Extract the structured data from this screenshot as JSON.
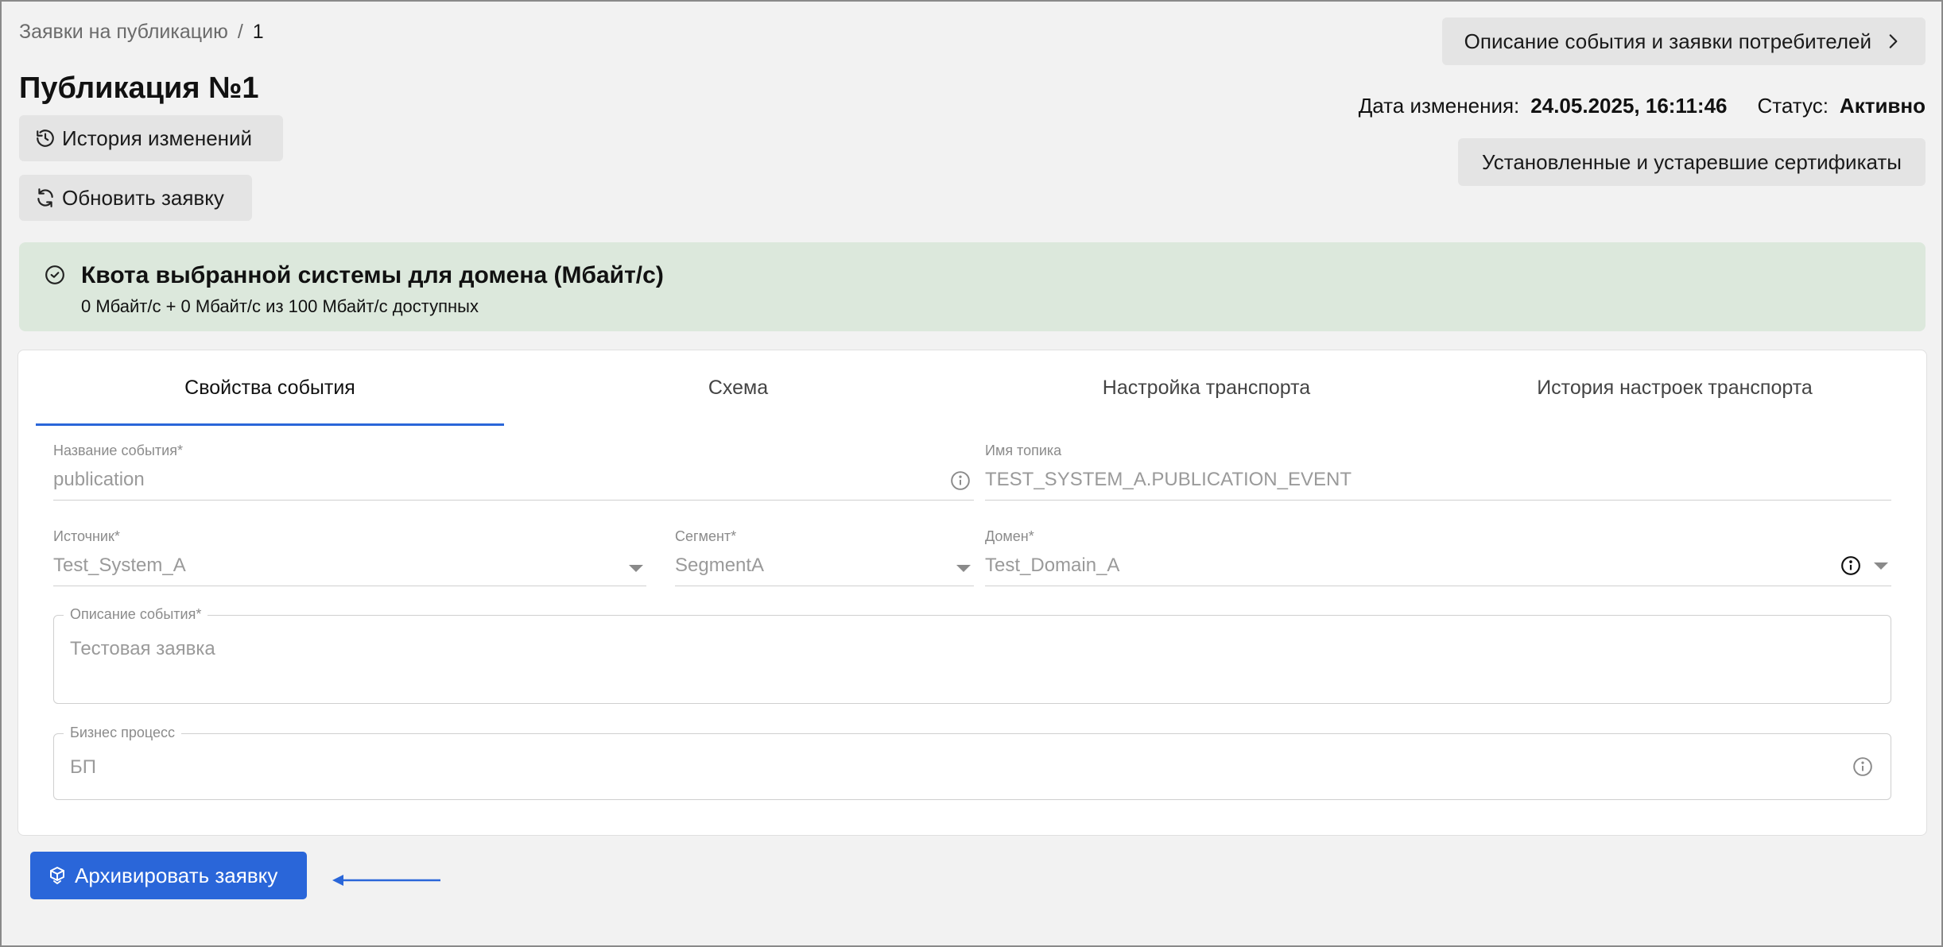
{
  "breadcrumb": {
    "parent": "Заявки на публикацию",
    "separator": "/",
    "current": "1"
  },
  "page": {
    "title": "Публикация №1"
  },
  "actions": {
    "history_label": "История изменений",
    "refresh_label": "Обновить заявку",
    "description_label": "Описание события и заявки потребителей",
    "certificates_label": "Установленные и устаревшие сертификаты",
    "archive_label": "Архивировать заявку"
  },
  "meta": {
    "modified_label": "Дата изменения:",
    "modified_value": "24.05.2025, 16:11:46",
    "status_label": "Статус:",
    "status_value": "Активно"
  },
  "quota": {
    "title": "Квота выбранной системы для домена (Мбайт/с)",
    "subtitle": "0 Мбайт/с + 0 Мбайт/с из 100 Мбайт/с доступных"
  },
  "tabs": [
    {
      "label": "Свойства события",
      "active": true
    },
    {
      "label": "Схема",
      "active": false
    },
    {
      "label": "Настройка транспорта",
      "active": false
    },
    {
      "label": "История настроек транспорта",
      "active": false
    }
  ],
  "form": {
    "event_name": {
      "label": "Название события",
      "required": "*",
      "value": "publication"
    },
    "topic_name": {
      "label": "Имя топика",
      "value": "TEST_SYSTEM_A.PUBLICATION_EVENT"
    },
    "source": {
      "label": "Источник",
      "required": "*",
      "value": "Test_System_A"
    },
    "segment": {
      "label": "Сегмент",
      "required": "*",
      "value": "SegmentA"
    },
    "domain": {
      "label": "Домен",
      "required": "*",
      "value": "Test_Domain_A"
    },
    "description": {
      "label": "Описание события",
      "required": "*",
      "value": "Тестовая заявка"
    },
    "business_process": {
      "label": "Бизнес процесс",
      "value": "БП"
    }
  },
  "colors": {
    "primary": "#2a66d9",
    "quota_bg": "#dce8dc",
    "page_bg": "#f2f2f2"
  },
  "icons": {
    "history": "history-icon",
    "refresh": "refresh-icon",
    "chevron": "chevron-right-icon",
    "quota": "check-circle-icon",
    "info": "info-icon",
    "caret": "caret-down-icon",
    "archive": "archive-icon"
  }
}
